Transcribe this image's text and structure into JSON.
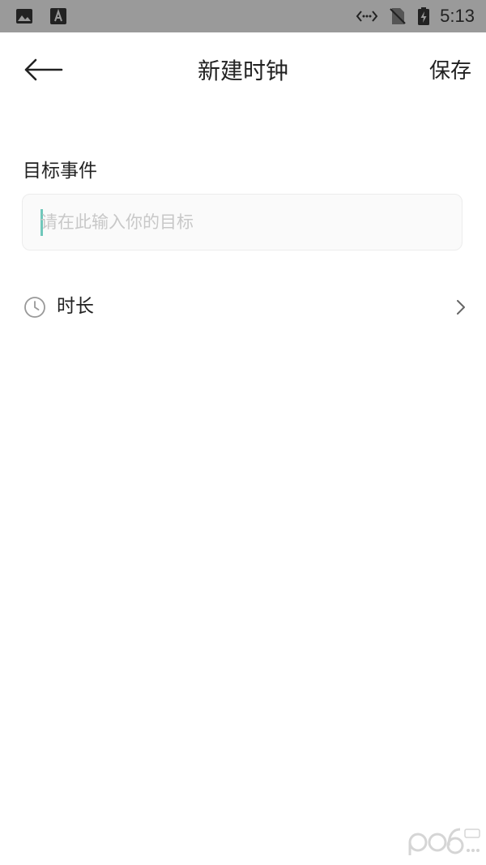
{
  "status_bar": {
    "time": "5:13",
    "icons": [
      "image-icon",
      "text-a-icon",
      "data-transfer-icon",
      "no-sim-icon",
      "battery-charging-icon"
    ]
  },
  "app_bar": {
    "back_icon": "arrow-left-icon",
    "title": "新建时钟",
    "save_label": "保存"
  },
  "form": {
    "goal_label": "目标事件",
    "goal_value": "",
    "goal_placeholder": "请在此输入你的目标",
    "duration_label": "时长",
    "duration_icon": "clock-icon",
    "duration_chevron": "chevron-right-icon"
  },
  "colors": {
    "status_bar_bg": "#9a9a9a",
    "caret": "#6fc7ba",
    "input_bg": "#fafafa",
    "text": "#222222",
    "placeholder": "#c8c8c8"
  }
}
